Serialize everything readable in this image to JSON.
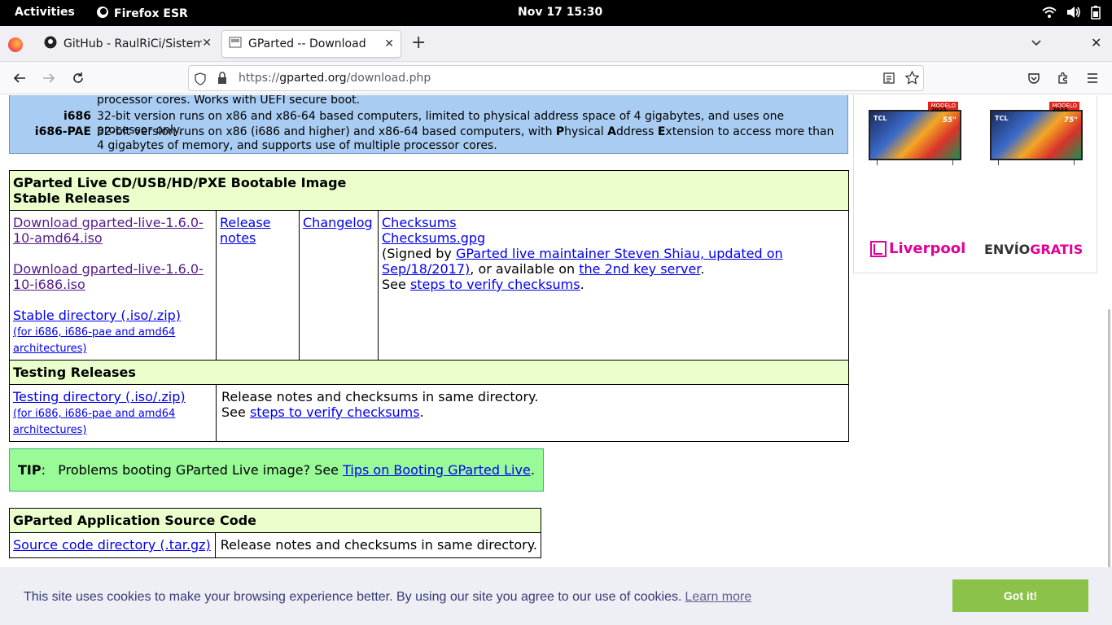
{
  "system_bar": {
    "activities": "Activities",
    "app_name": "Firefox ESR",
    "clock": "Nov 17  15:30"
  },
  "tabs": [
    {
      "title": "GitHub - RaulRiCi/Sistema",
      "active": false
    },
    {
      "title": "GParted -- Download",
      "active": true
    }
  ],
  "urlbar": {
    "prefix": "https://",
    "domain": "gparted.org",
    "path": "/download.php"
  },
  "arch": {
    "partial_desc": "processor cores. Works with UEFI secure boot.",
    "rows": [
      {
        "name": "i686",
        "desc": "32-bit version runs on x86 and x86-64 based computers, limited to physical address space of 4 gigabytes, and uses one processor only."
      },
      {
        "name": "i686-PAE",
        "desc_a": "32-bit version runs on x86 (i686 and higher) and x86-64 based computers, with ",
        "p": "P",
        "desc_b": "hysical ",
        "a": "A",
        "desc_c": "ddress ",
        "e": "E",
        "desc_d": "xtension to access more than 4 gigabytes of memory, and supports use of multiple processor cores."
      }
    ]
  },
  "live": {
    "header_line1": "GParted Live CD/USB/HD/PXE Bootable Image",
    "header_line2": "Stable Releases",
    "download_amd64": "Download gparted-live-1.6.0-10-amd64.iso",
    "download_i686": "Download gparted-live-1.6.0-10-i686.iso",
    "stable_dir": "Stable directory (.iso/.zip)",
    "stable_dir_note": "(for i686, i686-pae and amd64 architectures)",
    "release_notes": "Release notes",
    "changelog": "Changelog",
    "checksums": "Checksums",
    "checksums_gpg": "Checksums.gpg",
    "signed_prefix": "(Signed by ",
    "signed_link": "GParted live maintainer Steven Shiau, updated on Sep/18/2017)",
    "signed_mid": ", or available on ",
    "key_server": "the 2nd key server",
    "signed_end": ".",
    "see": "See ",
    "verify_steps": "steps to verify checksums",
    "period": ".",
    "testing_header": "Testing Releases",
    "testing_dir": "Testing directory (.iso/.zip)",
    "testing_dir_note": "(for i686, i686-pae and amd64 architectures)",
    "testing_notes": "Release notes and checksums in same directory.",
    "testing_see": "See ",
    "testing_verify": "steps to verify checksums",
    "testing_period": "."
  },
  "tip": {
    "label": "TIP",
    "colon": ":",
    "text": "Problems booting GParted Live image? See ",
    "link": "Tips on Booting GParted Live",
    "end": "."
  },
  "source": {
    "header": "GParted Application Source Code",
    "dir_link": "Source code directory (.tar.gz)",
    "notes": "Release notes and checksums in same directory."
  },
  "ad": {
    "tv1_size": "55\"",
    "tv2_size": "75\"",
    "tv_brand": "TCL",
    "tv_badge": "MODELO",
    "tv_year": "2025",
    "store": "Liverpool",
    "shipping_a": "ENVÍO",
    "shipping_b": "GRATIS"
  },
  "cookie": {
    "message": "This site uses cookies to make your browsing experience better. By using our site you agree to our use of cookies.",
    "learn_more": "Learn more",
    "button": "Got it!"
  },
  "colors": {
    "arch_bg": "#a9ccf2",
    "table_head_bg": "#eaffcc",
    "tip_bg": "#98fb98",
    "cookie_btn": "#8bc34a",
    "cookie_text": "#383b75"
  }
}
